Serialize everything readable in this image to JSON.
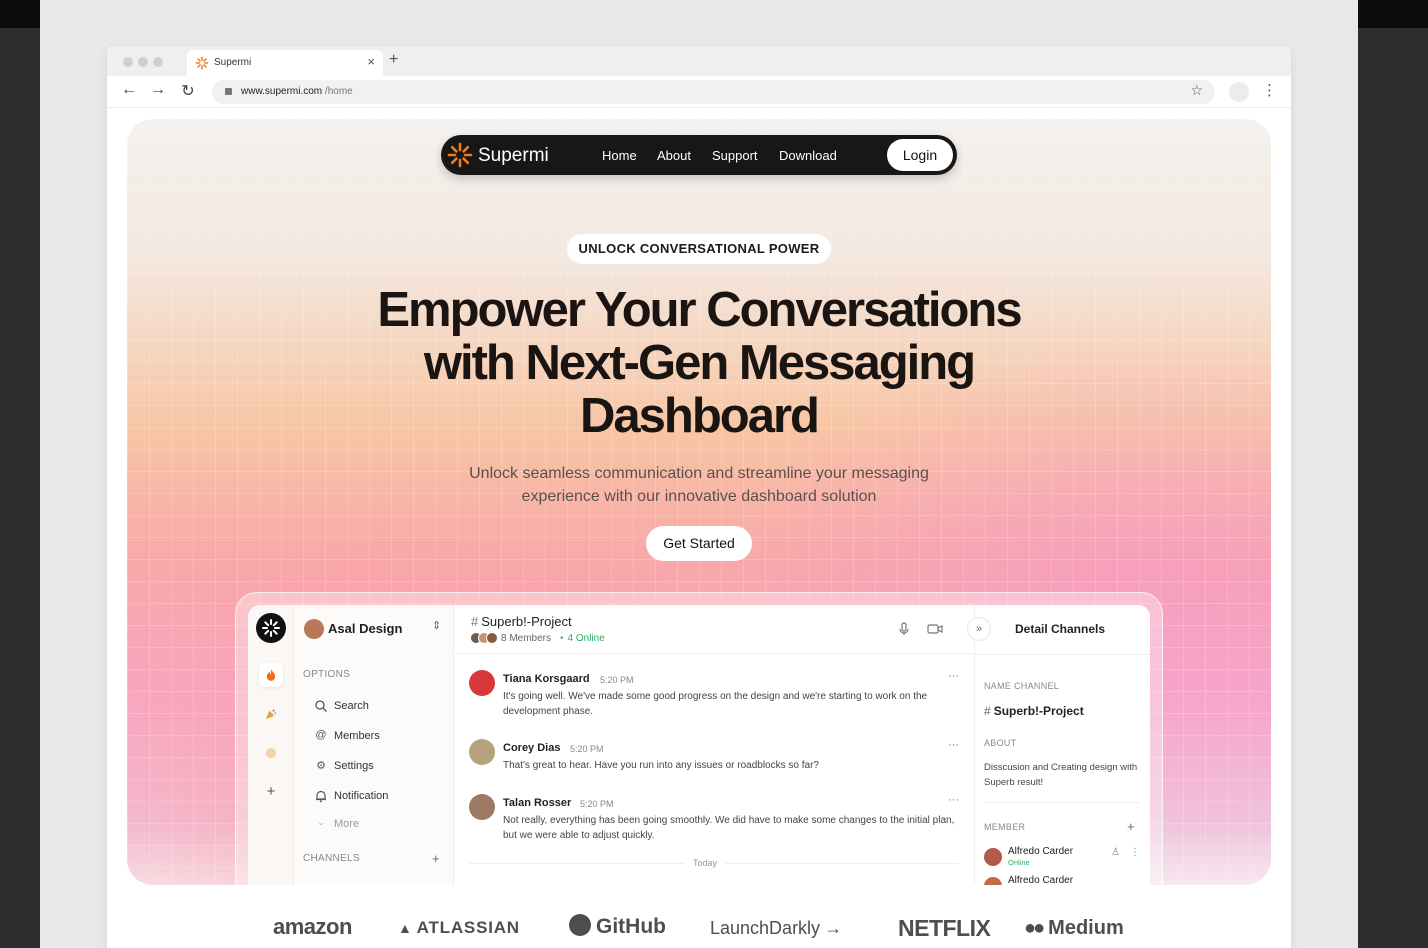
{
  "browser": {
    "tab_title": "Supermi",
    "tab_close": "×",
    "new_tab": "+",
    "url_domain": "www.supermi.com",
    "url_path": " /home",
    "back": "←",
    "forward": "→",
    "reload": "↻",
    "bookmark": "☆",
    "menu": "⋮"
  },
  "nav": {
    "logo_text": "Supermi",
    "links": [
      "Home",
      "About",
      "Support",
      "Download"
    ],
    "login": "Login"
  },
  "hero": {
    "eyebrow": "UNLOCK CONVERSATIONAL POWER",
    "headline": "Empower Your Conversations with Next-Gen Messaging Dashboard",
    "subtitle": "Unlock seamless communication and streamline your messaging experience with our innovative dashboard solution",
    "cta": "Get Started"
  },
  "dashboard": {
    "workspace": "Asal Design",
    "options_heading": "OPTIONS",
    "menu": [
      {
        "icon": "search-icon",
        "label": "Search"
      },
      {
        "icon": "at-icon",
        "label": "Members"
      },
      {
        "icon": "settings-icon",
        "label": "Settings"
      },
      {
        "icon": "bell-icon",
        "label": "Notification"
      },
      {
        "icon": "chevron-down-icon",
        "label": "More"
      }
    ],
    "channels_heading": "CHANNELS",
    "channel": {
      "name": "Superb!-Project",
      "members": "8 Members",
      "online": "4 Online"
    },
    "messages": [
      {
        "name": "Tiana Korsgaard",
        "time": "5:20 PM",
        "text": "It's going well. We've made some good progress on the design and we're starting to work on the development phase."
      },
      {
        "name": "Corey Dias",
        "time": "5:20 PM",
        "text": "That's great to hear. Have you run into any issues or roadblocks so far?"
      },
      {
        "name": "Talan Rosser",
        "time": "5:20 PM",
        "text": "Not really, everything has been going smoothly. We did have to make some changes to the initial plan, but we were able to adjust quickly."
      }
    ],
    "today_label": "Today",
    "detail": {
      "title": "Detail Channels",
      "name_heading": "NAME CHANNEL",
      "channel_name": "Superb!-Project",
      "about_heading": "ABOUT",
      "about_text": "Disscusion and Creating design with Superb result!",
      "member_heading": "MEMBER",
      "members": [
        {
          "name": "Alfredo Carder",
          "status": "Online"
        },
        {
          "name": "Alfredo Carder",
          "status": ""
        }
      ]
    }
  },
  "logos": [
    "amazon",
    "ATLASSIAN",
    "GitHub",
    "LaunchDarkly",
    "NETFLIX",
    "Medium"
  ],
  "colors": {
    "accent_orange": "#f27a1a",
    "nav_bg": "#171717",
    "online_green": "#27ae60"
  }
}
